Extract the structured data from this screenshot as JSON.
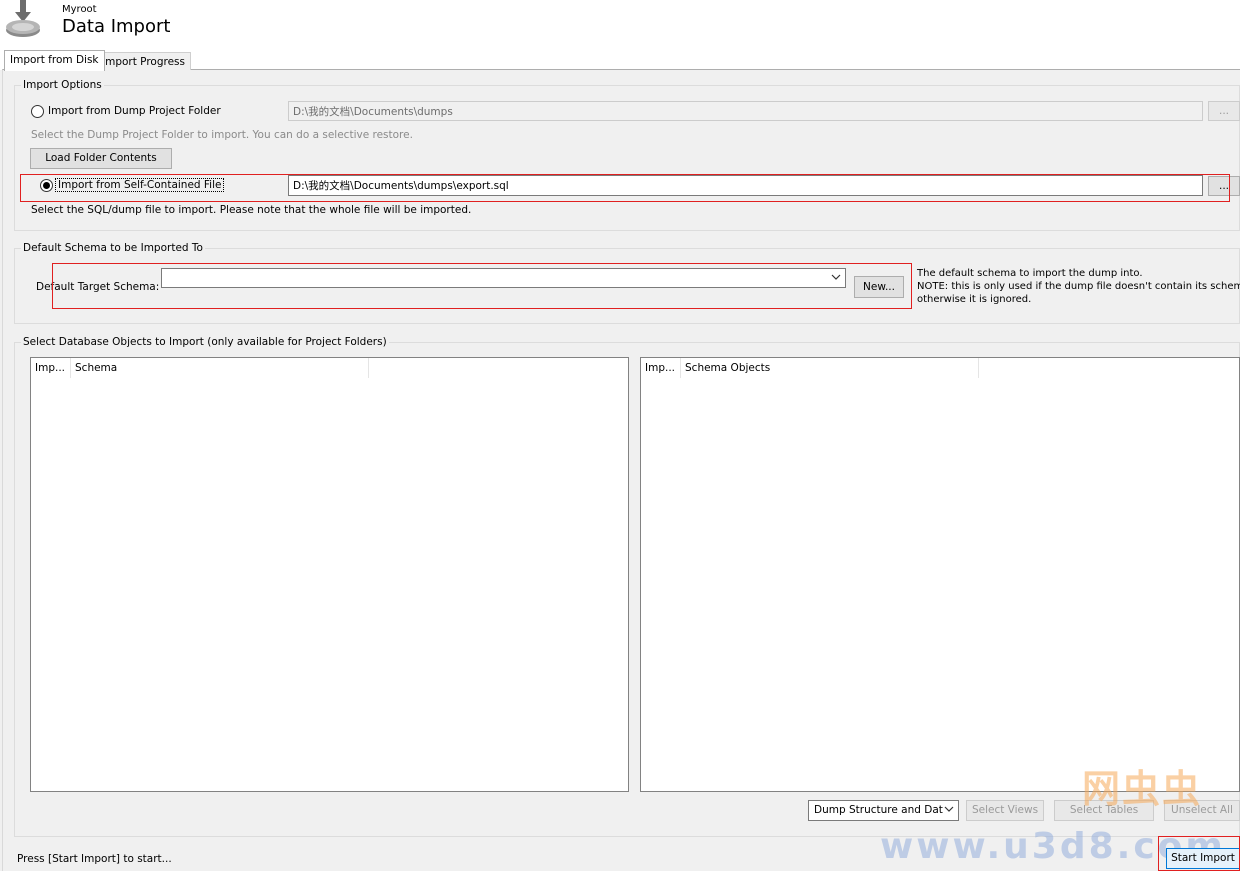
{
  "header": {
    "subtitle": "Myroot",
    "title": "Data Import",
    "icon": "download-disk-icon"
  },
  "tabs": [
    {
      "label": "Import from Disk",
      "active": true
    },
    {
      "label": "Import Progress",
      "active": false
    }
  ],
  "import_options": {
    "group_label": "Import Options",
    "dump_folder": {
      "label": "Import from Dump Project Folder",
      "selected": false,
      "path": "D:\\我的文档\\Documents\\dumps",
      "browse_label": "...",
      "hint": "Select the Dump Project Folder to import. You can do a selective restore.",
      "load_button": "Load Folder Contents"
    },
    "self_contained": {
      "label": "Import from Self-Contained File",
      "selected": true,
      "path": "D:\\我的文档\\Documents\\dumps\\export.sql",
      "browse_label": "...",
      "hint": "Select the SQL/dump file to import. Please note that the whole file will be imported."
    }
  },
  "default_schema": {
    "group_label": "Default Schema to be Imported To",
    "target_label": "Default Target Schema:",
    "target_value": "",
    "new_button": "New...",
    "note_line1": "The default schema to import the dump into.",
    "note_line2": "NOTE: this is only used if the dump file doesn't contain its schema,",
    "note_line3": "otherwise it is ignored."
  },
  "objects": {
    "group_label": "Select Database Objects to Import (only available for Project Folders)",
    "schema_list": {
      "col1": "Imp...",
      "col2": "Schema"
    },
    "objects_list": {
      "col1": "Imp...",
      "col2": "Schema Objects"
    },
    "dump_mode": "Dump Structure and Dat",
    "select_views": "Select Views",
    "select_tables": "Select Tables",
    "unselect_all": "Unselect All"
  },
  "status": "Press [Start Import] to start...",
  "start_import": "Start Import",
  "watermark": {
    "line1": "网虫虫",
    "line2": "www.u3d8.com"
  }
}
